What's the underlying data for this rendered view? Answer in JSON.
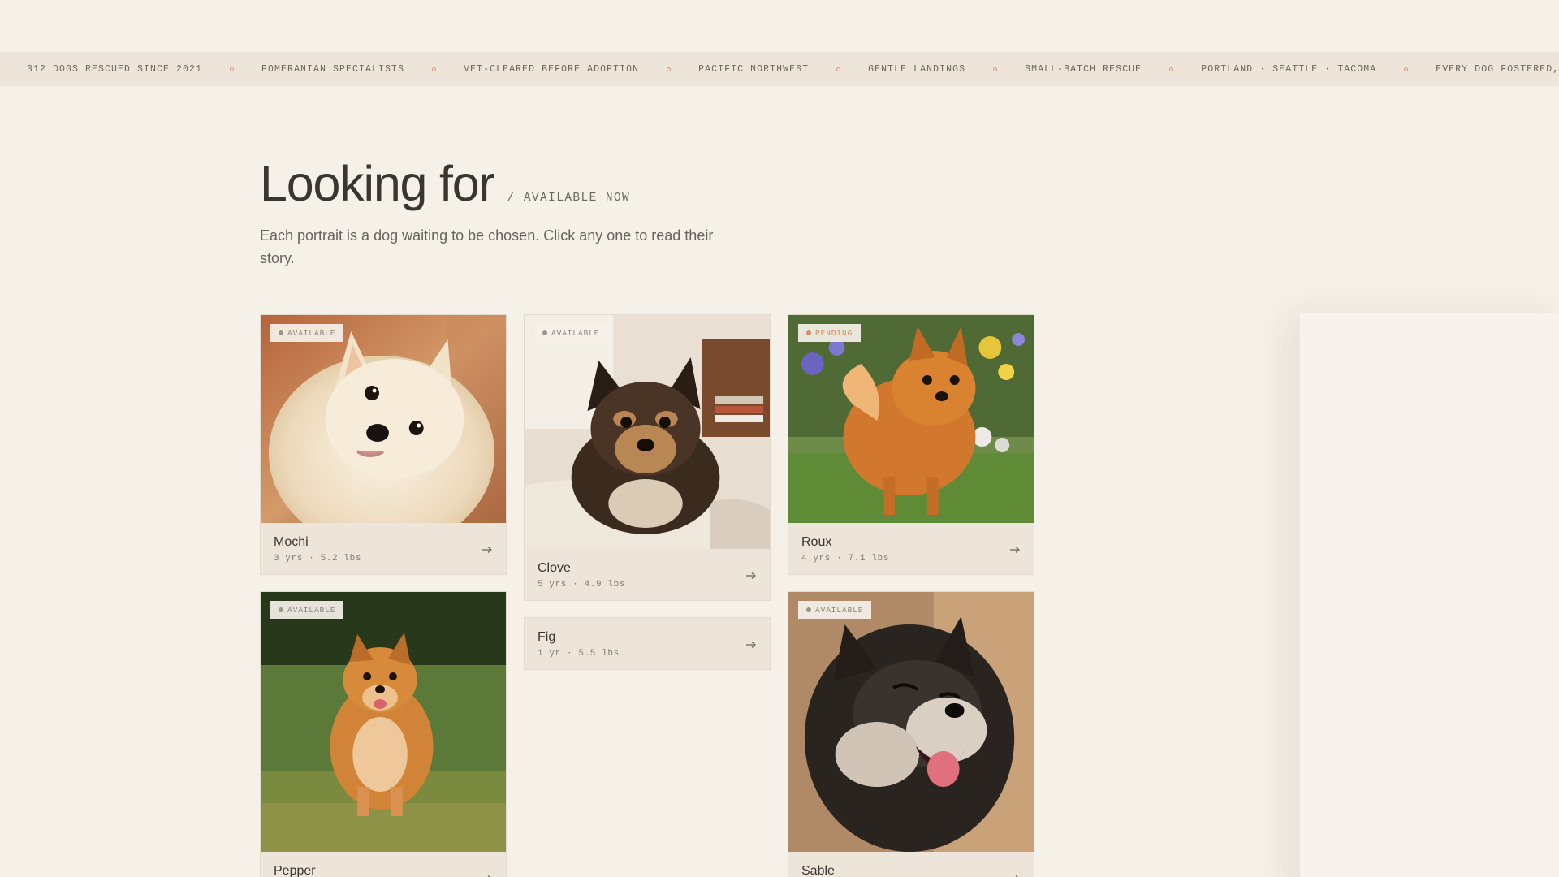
{
  "ticker": {
    "items": [
      "312 DOGS RESCUED SINCE 2021",
      "POMERANIAN SPECIALISTS",
      "VET-CLEARED BEFORE ADOPTION",
      "PACIFIC NORTHWEST",
      "GENTLE LANDINGS",
      "SMALL-BATCH RESCUE",
      "PORTLAND · SEATTLE · TACOMA",
      "EVERY DOG FOSTERED, NOT KEPT"
    ]
  },
  "header": {
    "title": "Looking for",
    "suffix": "/ AVAILABLE NOW",
    "subtitle": "Each portrait is a dog waiting to be chosen. Click any one to read their story."
  },
  "dogs": [
    {
      "name": "Mochi",
      "meta": "3 yrs · 5.2 lbs",
      "status": "AVAILABLE"
    },
    {
      "name": "Clove",
      "meta": "5 yrs · 4.9 lbs",
      "status": "AVAILABLE"
    },
    {
      "name": "Roux",
      "meta": "4 yrs · 7.1 lbs",
      "status": "PENDING"
    },
    {
      "name": "Pepper",
      "meta": "",
      "status": "AVAILABLE"
    },
    {
      "name": "Fig",
      "meta": "1 yr · 5.5 lbs",
      "status": ""
    },
    {
      "name": "Sable",
      "meta": "",
      "status": "AVAILABLE"
    }
  ],
  "icons": {
    "card_arrow": "arrow-right-icon",
    "status": "status-dot-icon"
  },
  "colors": {
    "background": "#f5f0e8",
    "ticker_background": "#ede5da",
    "card_background": "#ede5da",
    "pending": "#e08a5f",
    "text": "#3a3530"
  }
}
